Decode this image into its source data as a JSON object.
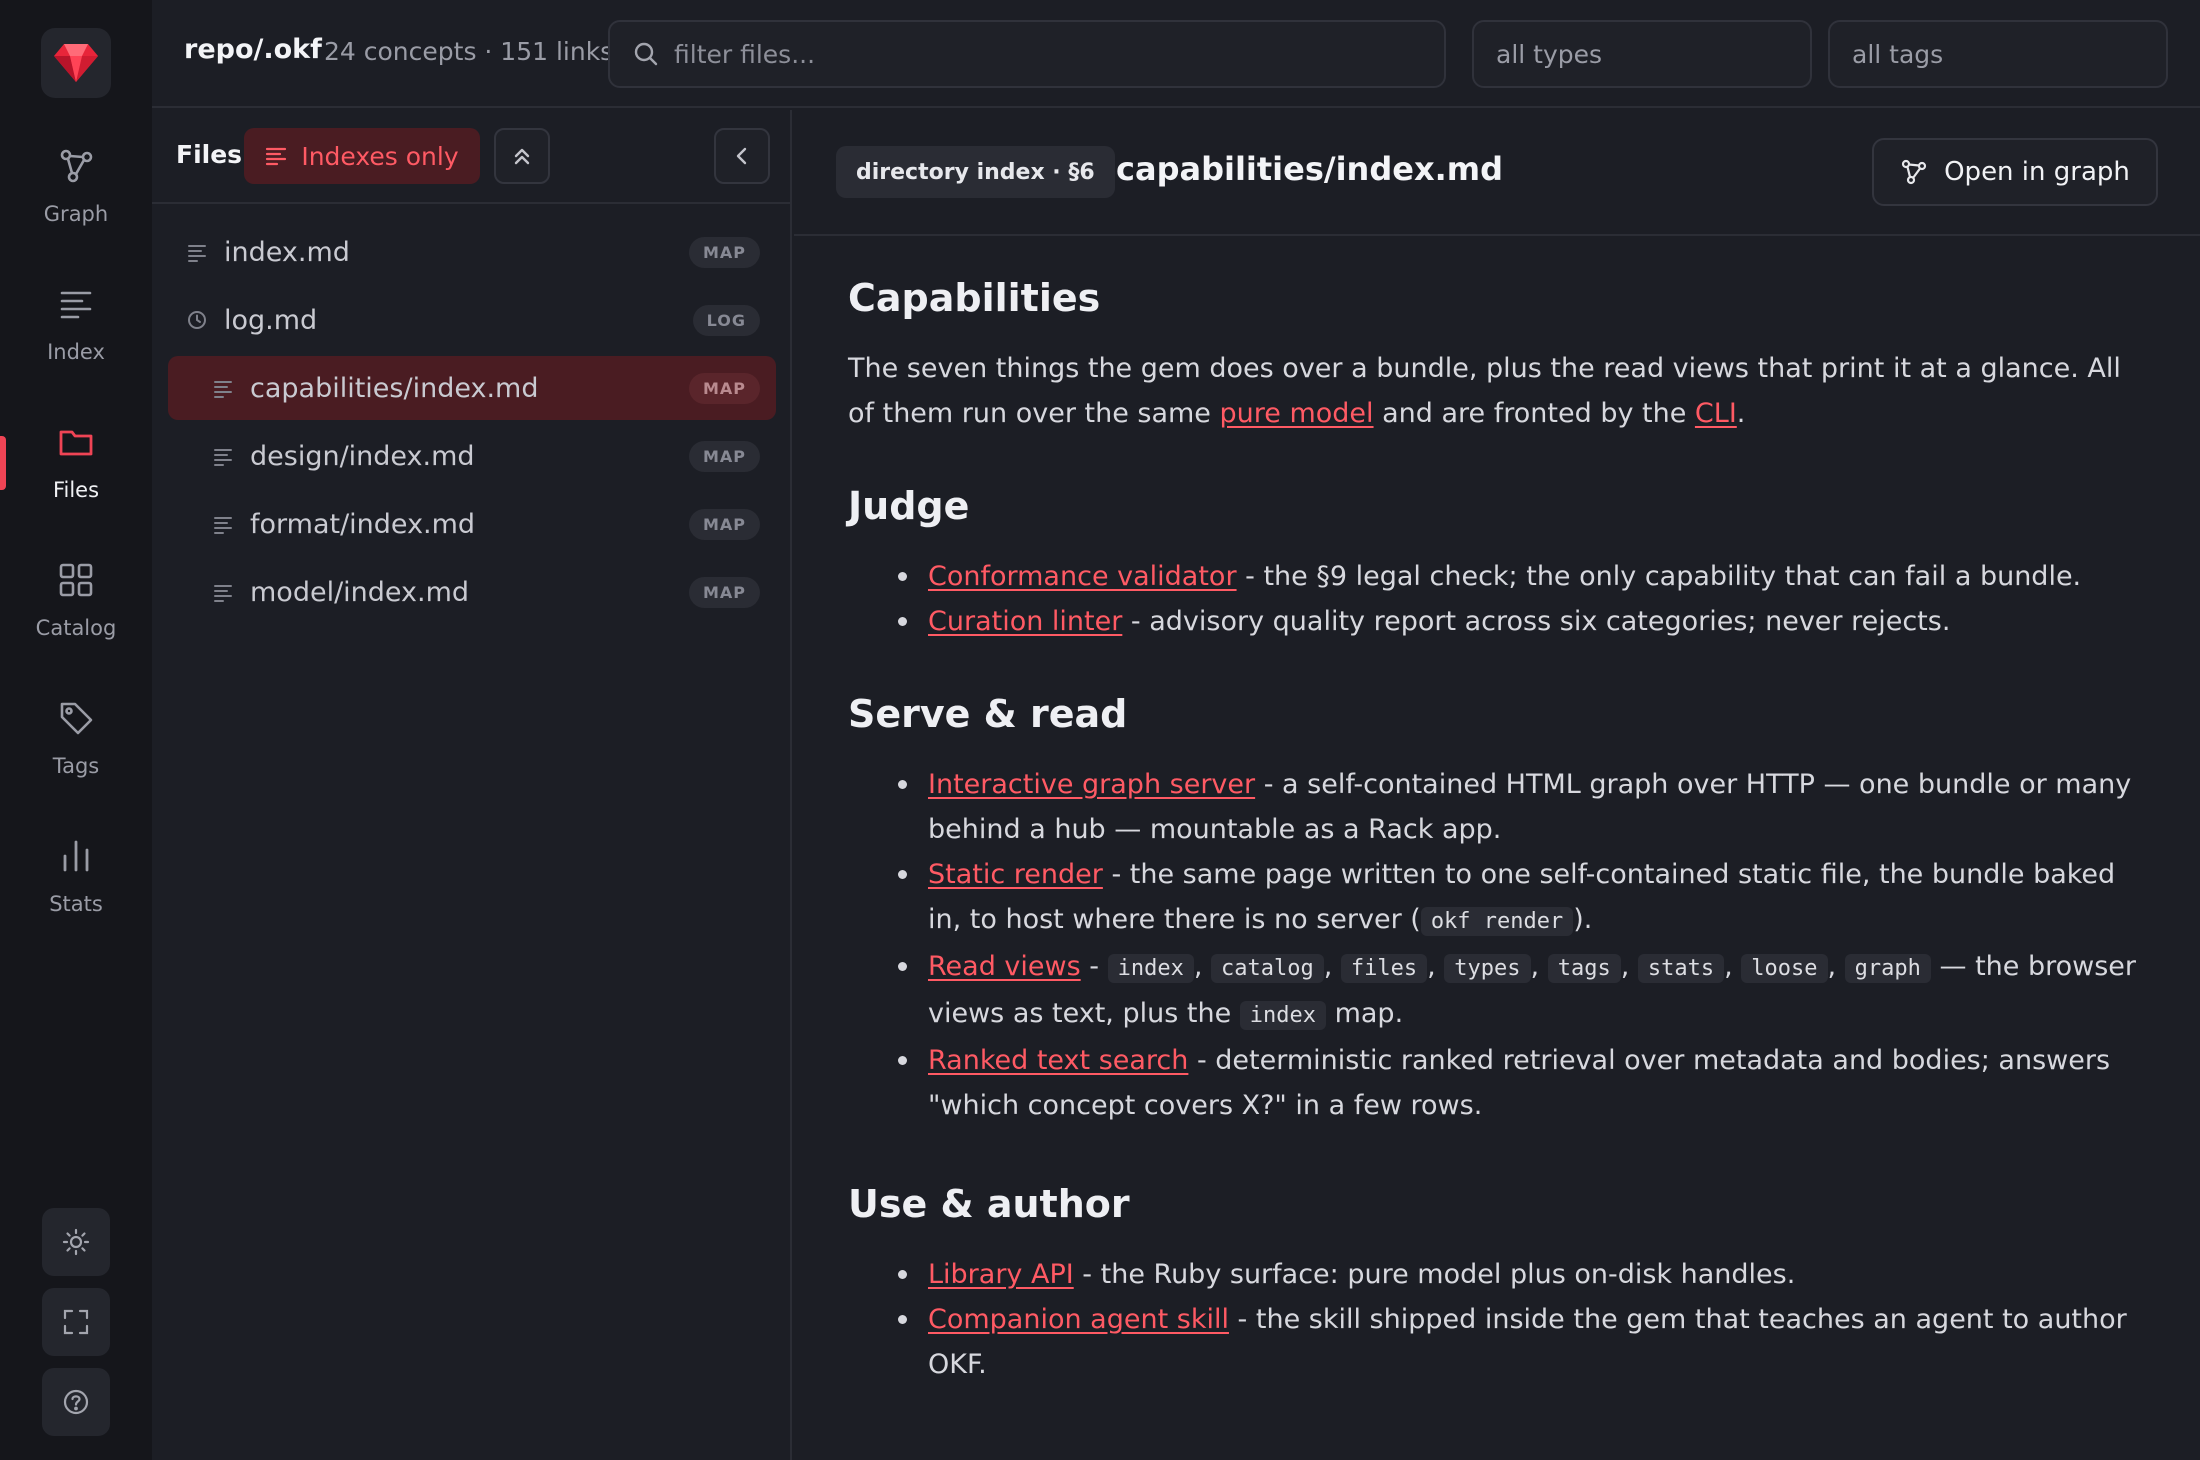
{
  "nav": {
    "items": [
      {
        "label": "Graph",
        "icon": "graph-icon"
      },
      {
        "label": "Index",
        "icon": "index-icon"
      },
      {
        "label": "Files",
        "icon": "folder-icon",
        "active": true
      },
      {
        "label": "Catalog",
        "icon": "catalog-icon"
      },
      {
        "label": "Tags",
        "icon": "tag-icon"
      },
      {
        "label": "Stats",
        "icon": "stats-icon"
      }
    ],
    "bottom_buttons": [
      "sun-icon",
      "fullscreen-icon",
      "help-icon"
    ]
  },
  "topbar": {
    "repo": "repo/.okf",
    "meta": "24 concepts · 151 links",
    "filter_placeholder": "filter files...",
    "types_select": "all types",
    "tags_select": "all tags"
  },
  "files_panel": {
    "title": "Files",
    "indexes_only_label": "Indexes only",
    "files": [
      {
        "name": "index.md",
        "badge": "MAP",
        "icon": "lines-icon",
        "indent": false,
        "selected": false
      },
      {
        "name": "log.md",
        "badge": "LOG",
        "icon": "clock-icon",
        "indent": false,
        "selected": false
      },
      {
        "name": "capabilities/index.md",
        "badge": "MAP",
        "icon": "lines-icon",
        "indent": true,
        "selected": true
      },
      {
        "name": "design/index.md",
        "badge": "MAP",
        "icon": "lines-icon",
        "indent": true,
        "selected": false
      },
      {
        "name": "format/index.md",
        "badge": "MAP",
        "icon": "lines-icon",
        "indent": true,
        "selected": false
      },
      {
        "name": "model/index.md",
        "badge": "MAP",
        "icon": "lines-icon",
        "indent": true,
        "selected": false
      }
    ]
  },
  "doc": {
    "badge": "directory index · §6",
    "path": "capabilities/index.md",
    "open_in_graph": "Open in graph",
    "title": "Capabilities",
    "intro": {
      "t1": "The seven things the gem does over a bundle, plus the read views that print it at a glance. All of them run over the same ",
      "link1": "pure model",
      "t2": " and are fronted by the ",
      "link2": "CLI",
      "t3": "."
    },
    "judge": {
      "heading": "Judge",
      "items": [
        {
          "link": "Conformance validator",
          "text": " - the §9 legal check; the only capability that can fail a bundle."
        },
        {
          "link": "Curation linter",
          "text": " - advisory quality report across six categories; never rejects."
        }
      ]
    },
    "serve": {
      "heading": "Serve & read",
      "interactive": {
        "link": "Interactive graph server",
        "text": " - a self-contained HTML graph over HTTP — one bundle or many behind a hub — mountable as a Rack app."
      },
      "static": {
        "link": "Static render",
        "text": " - the same page written to one self-contained static file, the bundle baked in, to host where there is no server (",
        "code": "okf render",
        "after": ")."
      },
      "read_views": {
        "link": "Read views",
        "dash": " - ",
        "codes": [
          "index",
          "catalog",
          "files",
          "types",
          "tags",
          "stats",
          "loose",
          "graph"
        ],
        "sep": ", ",
        "text_after": " — the browser views as text, plus the ",
        "code2": "index",
        "tail": " map."
      },
      "search": {
        "link": "Ranked text search",
        "text": " - deterministic ranked retrieval over metadata and bodies; answers \"which concept covers X?\" in a few rows."
      }
    },
    "use": {
      "heading": "Use & author",
      "items": [
        {
          "link": "Library API",
          "text": " - the Ruby surface: pure model plus on-disk handles."
        },
        {
          "link": "Companion agent skill",
          "text": " - the skill shipped inside the gem that teaches an agent to author OKF."
        }
      ]
    }
  },
  "colors": {
    "accent": "#ef4455",
    "link": "#ff5a64",
    "background": "#1c1e25",
    "rail": "#15161b"
  }
}
